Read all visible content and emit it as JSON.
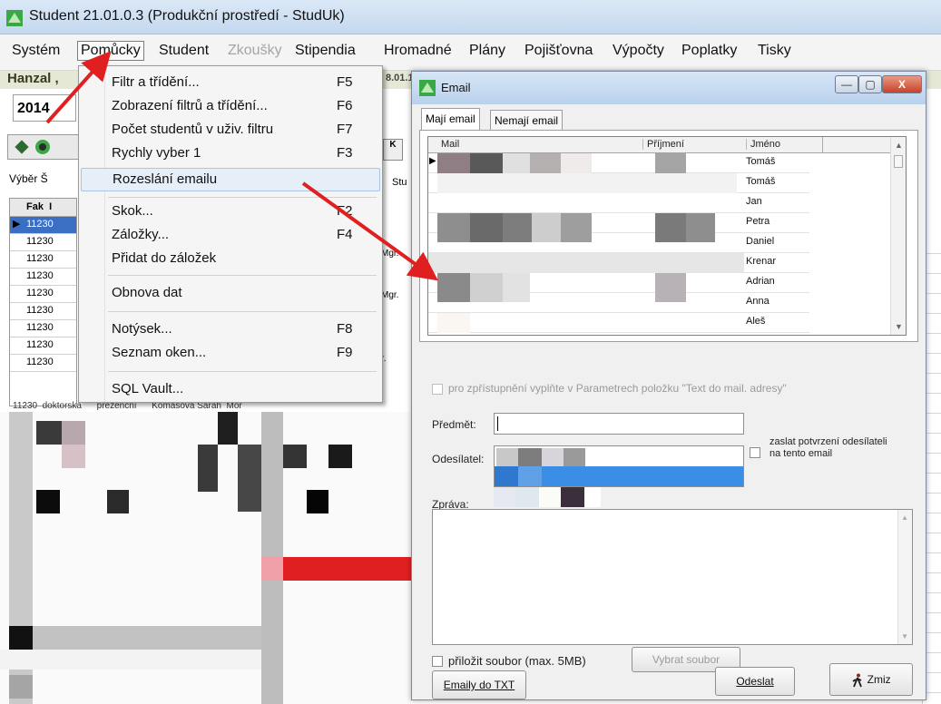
{
  "main_window": {
    "title": "Student  21.01.0.3  (Produkční prostředí - StudUk)"
  },
  "menubar": {
    "items": [
      {
        "label": "Systém",
        "state": "normal"
      },
      {
        "label": "Pomůcky",
        "state": "active"
      },
      {
        "label": "Student",
        "state": "normal"
      },
      {
        "label": "Zkoušky",
        "state": "disabled"
      },
      {
        "label": "Stipendia",
        "state": "normal"
      },
      {
        "label": "Hromadné",
        "state": "normal"
      },
      {
        "label": "Plány",
        "state": "normal"
      },
      {
        "label": "Pojišťovna",
        "state": "normal"
      },
      {
        "label": "Výpočty",
        "state": "normal"
      },
      {
        "label": "Poplatky",
        "state": "normal"
      },
      {
        "label": "Tisky",
        "state": "normal"
      }
    ]
  },
  "background": {
    "student_name": "Hanzal ,",
    "year": "2014",
    "tabs_label": "Výběr  Š",
    "grid_headers": [
      "Fak",
      "I"
    ],
    "grid_rows": [
      "11230",
      "11230",
      "11230",
      "11230",
      "11230",
      "11230",
      "11230",
      "11230",
      "11230"
    ],
    "peek_texts": {
      "date_fragment": "8.01.1",
      "study_tab": "Stu",
      "k_btn": "K",
      "mgr1": "Mgr.",
      "mgr2": "Mgr.",
      "r_frag": "r.",
      "last_row": "11230  doktorská      prezenční      Komasova Sarah  Mor"
    }
  },
  "pomucky_menu": {
    "items": [
      {
        "label": "Filtr a třídění...",
        "shortcut": "F5"
      },
      {
        "label": "Zobrazení filtrů a třídění...",
        "shortcut": "F6"
      },
      {
        "label": "Počet studentů v uživ. filtru",
        "shortcut": "F7"
      },
      {
        "label": "Rychly vyber 1",
        "shortcut": "F3"
      },
      {
        "label": "Rozeslání emailu",
        "shortcut": "",
        "highlighted": true
      },
      {
        "label": "Skok...",
        "shortcut": "F2"
      },
      {
        "label": "Záložky...",
        "shortcut": "F4"
      },
      {
        "label": "Přidat do záložek",
        "shortcut": ""
      },
      {
        "label": "Obnova dat",
        "shortcut": ""
      },
      {
        "label": "Notýsek...",
        "shortcut": "F8"
      },
      {
        "label": "Seznam oken...",
        "shortcut": "F9"
      },
      {
        "label": "SQL Vault...",
        "shortcut": ""
      }
    ]
  },
  "email_dialog": {
    "title": "Email",
    "tabs": [
      {
        "label": "Mají email",
        "active": true
      },
      {
        "label": "Nemají email",
        "active": false
      }
    ],
    "grid_headers": {
      "mail": "Mail",
      "surname": "Příjmení",
      "firstname": "Jméno"
    },
    "recipients": [
      {
        "firstname": "Tomáš"
      },
      {
        "firstname": "Tomáš"
      },
      {
        "firstname": "Jan"
      },
      {
        "firstname": "Petra"
      },
      {
        "firstname": "Daniel"
      },
      {
        "firstname": "Krenar"
      },
      {
        "firstname": "Adrian"
      },
      {
        "firstname": "Anna"
      },
      {
        "firstname": "Aleš"
      }
    ],
    "param_note": "pro zpřístupnění vyplňte v Parametrech položku \"Text do mail. adresy\"",
    "subject_label": "Předmět:",
    "subject_value": "",
    "sender_label": "Odesílatel:",
    "confirm_label": "zaslat potvrzení odesílateli na tento email",
    "message_label": "Zpráva:",
    "attach_label": "přiložit soubor (max. 5MB)",
    "choose_file_button": "Vybrat soubor",
    "export_button": "Emaily do TXT",
    "send_button": "Odeslat",
    "close_button": "Zmiz",
    "window_buttons": {
      "minimize": "—",
      "maximize": "▢",
      "close": "X"
    }
  },
  "colors": {
    "menu_highlight": "#e6eef8",
    "sender_selection": "#3a8ee6",
    "annotation_arrow": "#e02020",
    "selected_row": "#3a6fc4"
  }
}
